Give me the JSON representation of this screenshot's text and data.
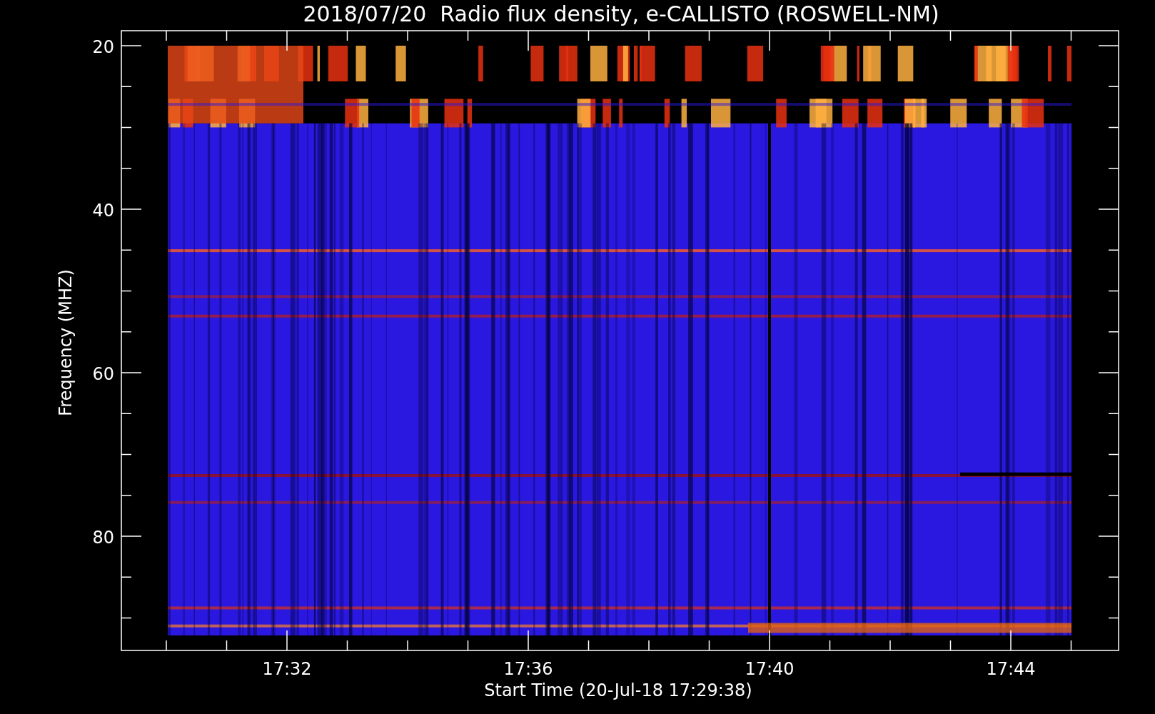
{
  "title": "2018/07/20  Radio flux density, e-CALLISTO (ROSWELL-NM)",
  "y_axis": {
    "label": "Frequency (MHZ)",
    "ticks": [
      "20",
      "40",
      "60",
      "80"
    ]
  },
  "x_axis": {
    "label": "Start Time (20-Jul-18 17:29:38)",
    "ticks": [
      "17:32",
      "17:36",
      "17:40",
      "17:44"
    ]
  }
}
